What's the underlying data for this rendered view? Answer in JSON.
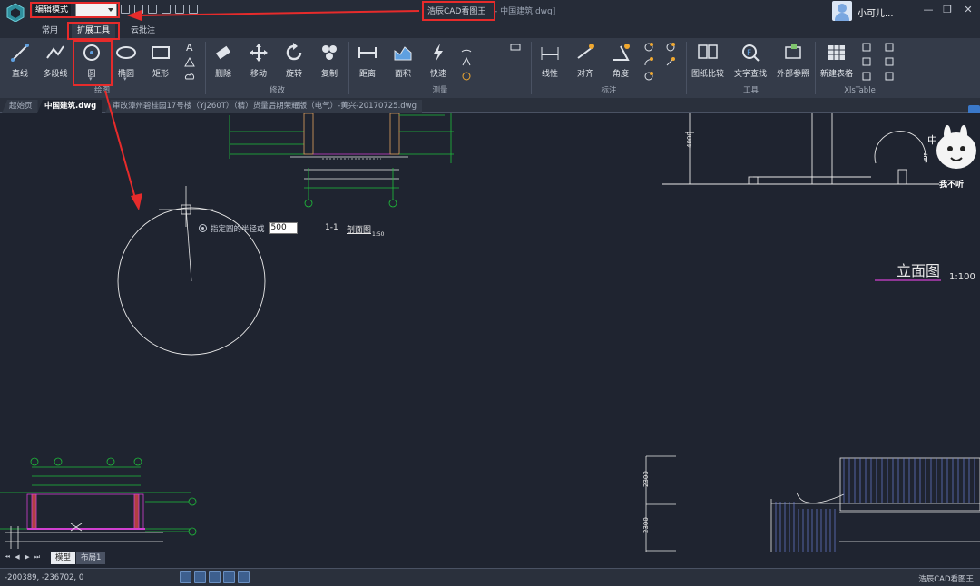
{
  "titlebar": {
    "mode_label": "编辑模式",
    "mode_value": "",
    "app_name": "浩辰CAD看图王",
    "doc_name": "- 中国建筑.dwg]",
    "user_name": "小可儿...",
    "min_icon": "—",
    "max_icon": "❐",
    "close_icon": "✕"
  },
  "ribbon_tabs": [
    "常用",
    "扩展工具",
    "云批注"
  ],
  "ribbon": {
    "draw": {
      "label": "绘图",
      "tools": [
        "直线",
        "多段线",
        "圆",
        "椭圆",
        "矩形"
      ]
    },
    "modify": {
      "label": "修改",
      "tools": [
        "删除",
        "移动",
        "旋转",
        "复制"
      ]
    },
    "measure": {
      "label": "测量",
      "tools": [
        "距离",
        "面积",
        "快速"
      ]
    },
    "annotate": {
      "label": "标注",
      "tools": [
        "线性",
        "对齐",
        "角度"
      ]
    },
    "tools": {
      "label": "工具",
      "tools": [
        "图纸比较",
        "文字查找",
        "外部参照"
      ]
    },
    "xls": {
      "label": "XlsTable",
      "tools": [
        "新建表格"
      ]
    }
  },
  "doc_tabs": [
    "起始页",
    "中国建筑.dwg",
    "审改漳州碧桂园17号楼（YJ260T）（精）货量后期荣耀版（电气）-黄兴-20170725.dwg"
  ],
  "canvas": {
    "prompt_text": "指定圆的半径或",
    "prompt_value": "500",
    "section_label": "1-1",
    "section_title": "剖面图",
    "section_scale": "1:50",
    "elev_title": "立面图",
    "elev_scale": "1:100",
    "elev_dim_top": "4000",
    "elev_dim_mid": "2300",
    "elev_dim_bot": "2300",
    "sticker_text": "我不听"
  },
  "layout_tabs": [
    "模型",
    "布局1"
  ],
  "layout_nav": [
    "⏮",
    "◀",
    "▶",
    "⏭"
  ],
  "status": {
    "coords": "-200389, -236702, 0",
    "brand": "浩辰CAD看图王"
  },
  "colors": {
    "bg": "#1f2430",
    "ribbon": "#343b49",
    "highlight": "#e62b2b"
  }
}
